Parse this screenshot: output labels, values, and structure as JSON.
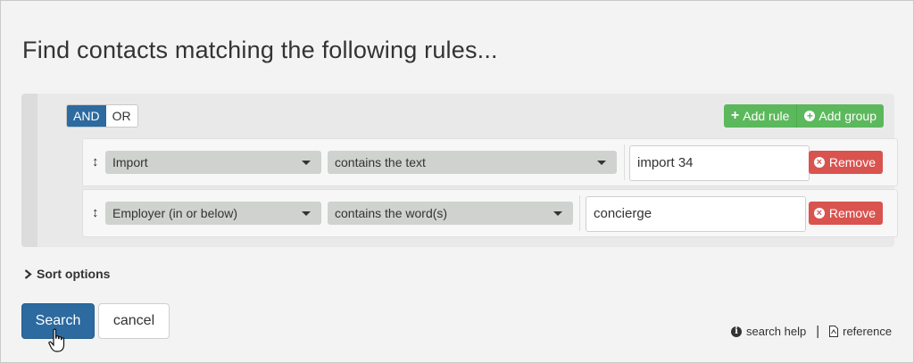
{
  "page": {
    "title": "Find contacts matching the following rules..."
  },
  "group": {
    "and_label": "AND",
    "or_label": "OR",
    "add_rule_label": "Add rule",
    "add_group_label": "Add group"
  },
  "rules": [
    {
      "handle": "↕",
      "field": "Import",
      "operator": "contains the text",
      "value": "import 34",
      "remove_label": "Remove"
    },
    {
      "handle": "↕",
      "field": "Employer (in or below)",
      "operator": "contains the word(s)",
      "value": "concierge",
      "remove_label": "Remove"
    }
  ],
  "sort": {
    "label": "Sort options"
  },
  "actions": {
    "search_label": "Search",
    "cancel_label": "cancel"
  },
  "help": {
    "search_help_label": "search help",
    "separator": "|",
    "reference_label": "reference"
  },
  "colors": {
    "primary": "#2c6aa0",
    "success": "#5cb85c",
    "danger": "#d9534f"
  },
  "icons": {
    "move": "move-handle-icon",
    "add": "plus-icon",
    "add_group": "plus-circle-icon",
    "remove": "times-circle-icon",
    "info": "info-circle-icon",
    "reference": "pdf-file-icon",
    "chevron": "chevron-right-icon",
    "cursor": "hand-pointer-icon"
  }
}
